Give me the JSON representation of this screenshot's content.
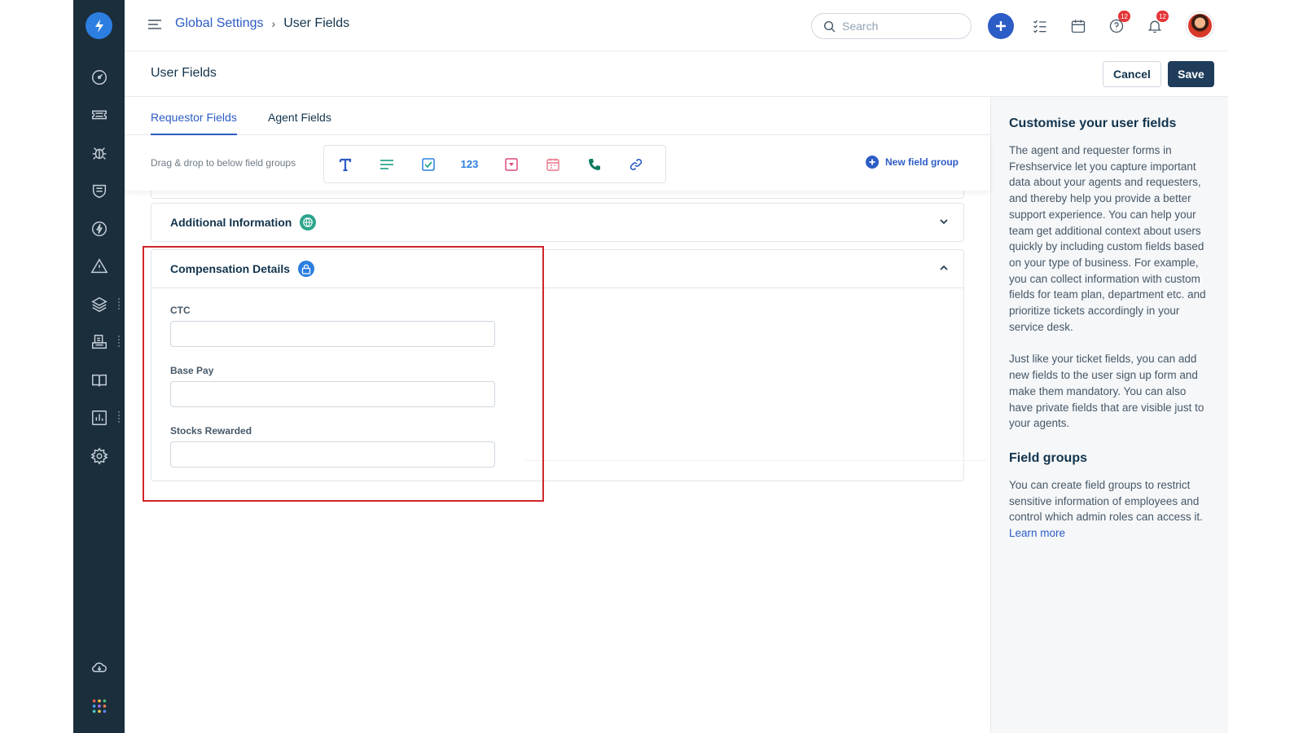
{
  "header": {
    "breadcrumb_parent": "Global Settings",
    "breadcrumb_separator": "›",
    "breadcrumb_current": "User Fields",
    "search_placeholder": "Search",
    "help_badge": "12",
    "notification_badge": "12"
  },
  "subheader": {
    "title": "User Fields",
    "cancel_label": "Cancel",
    "save_label": "Save"
  },
  "tabs": [
    {
      "label": "Requestor Fields",
      "active": true
    },
    {
      "label": "Agent Fields",
      "active": false
    }
  ],
  "toolbar": {
    "hint": "Drag & drop to below field groups",
    "number_label": "123",
    "new_group_label": "New field group",
    "palette_icons": [
      "text-icon",
      "paragraph-icon",
      "checkbox-icon",
      "number-icon",
      "dropdown-icon",
      "date-icon",
      "phone-icon",
      "url-icon"
    ]
  },
  "groups": [
    {
      "title": "Additional Information",
      "icon": "globe-icon",
      "expanded": false
    },
    {
      "title": "Compensation Details",
      "icon": "lock-icon",
      "expanded": true,
      "fields": [
        {
          "label": "CTC",
          "value": ""
        },
        {
          "label": "Base Pay",
          "value": ""
        },
        {
          "label": "Stocks Rewarded",
          "value": ""
        }
      ]
    }
  ],
  "right_panel": {
    "heading1": "Customise your user fields",
    "para1": "The agent and requester forms in Freshservice let you capture important data about your agents and requesters, and thereby help you provide a better support experience. You can help your team get additional context about users quickly by including custom fields based on your type of business. For example, you can collect information with custom fields for team plan, department etc. and prioritize tickets accordingly in your service desk.",
    "para2": "Just like your ticket fields, you can add new fields to the user sign up form and make them mandatory. You can also have private fields that are visible just to your agents.",
    "heading2": "Field groups",
    "para3": "You can create field groups to restrict sensitive information of employees and control which admin roles can access it.",
    "learn_more": "Learn more"
  },
  "colors": {
    "sidebar_bg": "#1b2e3c",
    "accent": "#2c5cc5",
    "save_bg": "#1f3c5a",
    "highlight": "#d0262a",
    "badge": "#e43538"
  },
  "sidebar_icons": [
    "dashboard-icon",
    "tickets-icon",
    "problems-icon",
    "changes-icon",
    "releases-icon",
    "alerts-icon",
    "assets-icon",
    "purchase-icon",
    "solutions-icon",
    "reports-icon",
    "admin-icon",
    "cloud-icon",
    "apps-grid-icon"
  ]
}
